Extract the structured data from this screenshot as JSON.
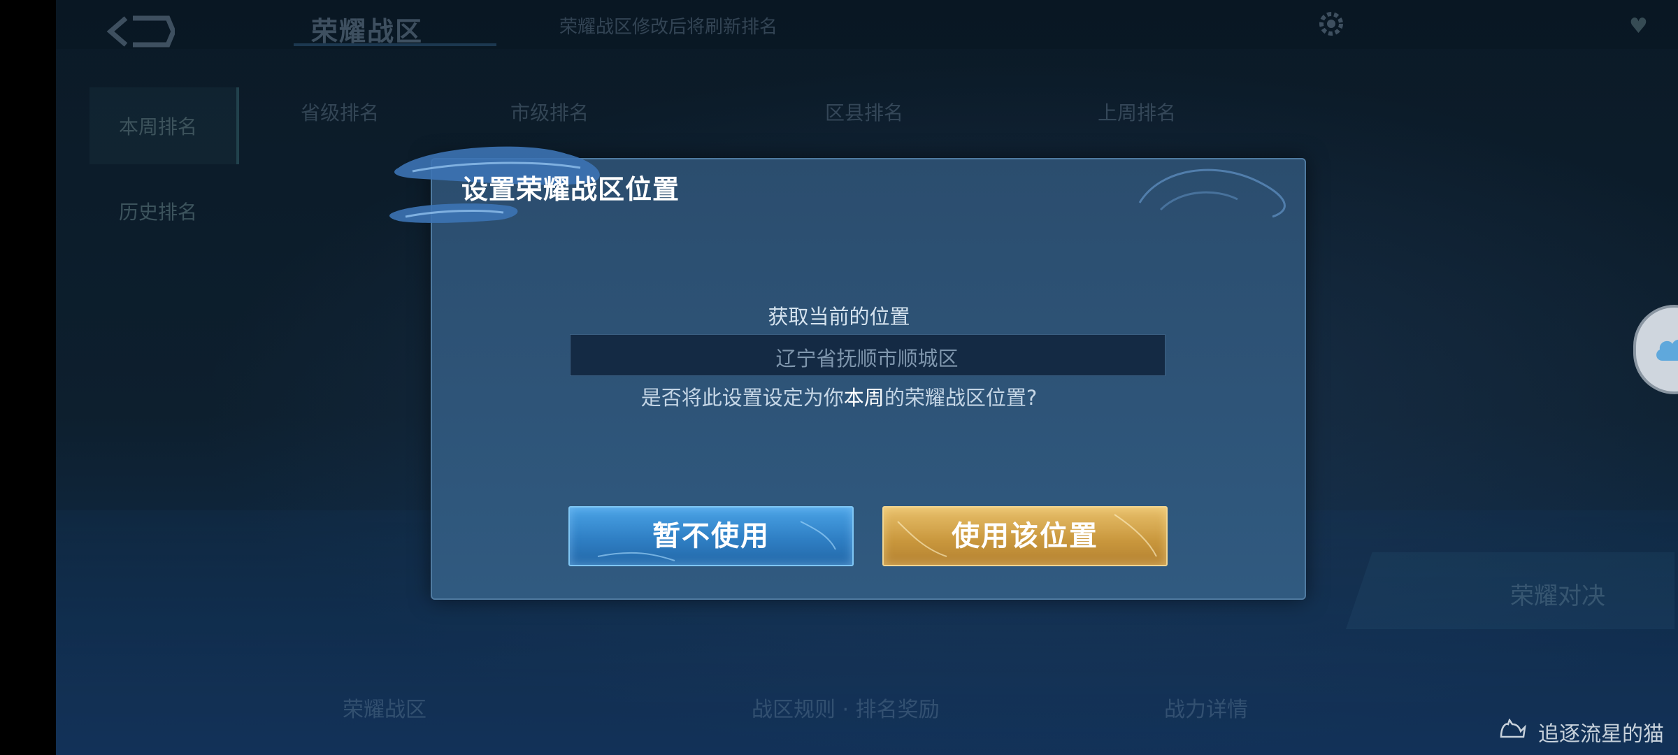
{
  "background": {
    "top_title": "荣耀战区",
    "top_notice": "荣耀战区修改后将刷新排名",
    "sidebar": [
      "本周排名",
      "历史排名"
    ],
    "subtabs": [
      "省级排名",
      "市级排名",
      "区县排名",
      "上周排名"
    ],
    "bottom_items": [
      "荣耀战区",
      "战区规则 · 排名奖励",
      "战力详情"
    ],
    "bottom_right_label": "荣耀对决"
  },
  "dialog": {
    "title": "设置荣耀战区位置",
    "subtitle": "获取当前的位置",
    "location": "辽宁省抚顺市顺城区",
    "confirm_prefix": "是否将此设置设定为你",
    "confirm_highlight": "本周",
    "confirm_suffix": "的荣耀战区位置?",
    "cancel_label": "暂不使用",
    "confirm_label": "使用该位置"
  },
  "watermark": "追逐流星的猫",
  "colors": {
    "dialog_bg": "#2e5478",
    "cancel_button": "#2f7fc4",
    "confirm_button": "#c8963c"
  },
  "icons": {
    "back": "back-arrow-icon",
    "settings": "gear-icon",
    "cloud": "cloud-icon"
  }
}
